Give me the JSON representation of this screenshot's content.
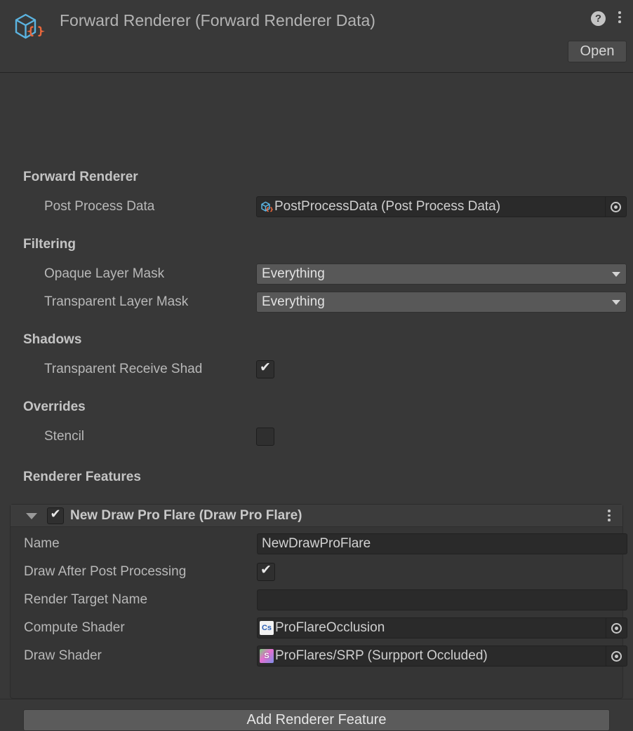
{
  "header": {
    "title": "Forward Renderer (Forward Renderer Data)",
    "icon": "scriptable-object-cube-icon",
    "help_label": "?",
    "open_label": "Open",
    "menu_icon": "kebab-menu-icon"
  },
  "sections": [
    {
      "title": "Forward Renderer",
      "rows": [
        {
          "label": "Post Process Data",
          "type": "object",
          "value": "PostProcessData (Post Process Data)",
          "icon": "scriptable-object-cube-icon",
          "picker_icon": "object-picker-icon"
        }
      ]
    },
    {
      "title": "Filtering",
      "rows": [
        {
          "label": "Opaque Layer Mask",
          "type": "dropdown",
          "value": "Everything",
          "icon": "chevron-down-icon"
        },
        {
          "label": "Transparent Layer Mask",
          "type": "dropdown",
          "value": "Everything",
          "icon": "chevron-down-icon"
        }
      ]
    },
    {
      "title": "Shadows",
      "rows": [
        {
          "label": "Transparent Receive Shad",
          "type": "checkbox",
          "checked": true,
          "mark": "✔"
        }
      ]
    },
    {
      "title": "Overrides",
      "rows": [
        {
          "label": "Stencil",
          "type": "checkbox",
          "checked": false,
          "mark": ""
        }
      ]
    },
    {
      "title": "Renderer Features",
      "rows": []
    }
  ],
  "feature": {
    "foldout_icon": "triangle-down-icon",
    "enabled": true,
    "enabled_mark": "✔",
    "title": "New Draw Pro Flare (Draw Pro Flare)",
    "menu_icon": "kebab-menu-icon",
    "rows": [
      {
        "label": "Name",
        "type": "text",
        "value": "NewDrawProFlare",
        "placeholder": ""
      },
      {
        "label": "Draw After Post Processing",
        "type": "checkbox",
        "checked": true,
        "mark": "✔"
      },
      {
        "label": "Render Target Name",
        "type": "text",
        "value": "",
        "placeholder": ""
      },
      {
        "label": "Compute Shader",
        "type": "object",
        "value": "ProFlareOcclusion",
        "icon": "compute-shader-icon",
        "icon_text": "Cs",
        "picker_icon": "object-picker-icon"
      },
      {
        "label": "Draw Shader",
        "type": "object",
        "value": "ProFlares/SRP (Surpport Occluded)",
        "icon": "shader-icon",
        "icon_text": "S",
        "picker_icon": "object-picker-icon"
      }
    ]
  },
  "footer": {
    "add_label": "Add Renderer Feature"
  },
  "colors": {
    "window_bg": "#383838",
    "header_bg": "#393939",
    "field_bg": "#2a2a2a",
    "dropdown_bg": "#585858",
    "panel_bg": "#353535",
    "panel_head_bg": "#3c3c3c",
    "text": "#b8b8b8",
    "accent_blue": "#5bb3e0",
    "accent_orange": "#e8673c"
  }
}
